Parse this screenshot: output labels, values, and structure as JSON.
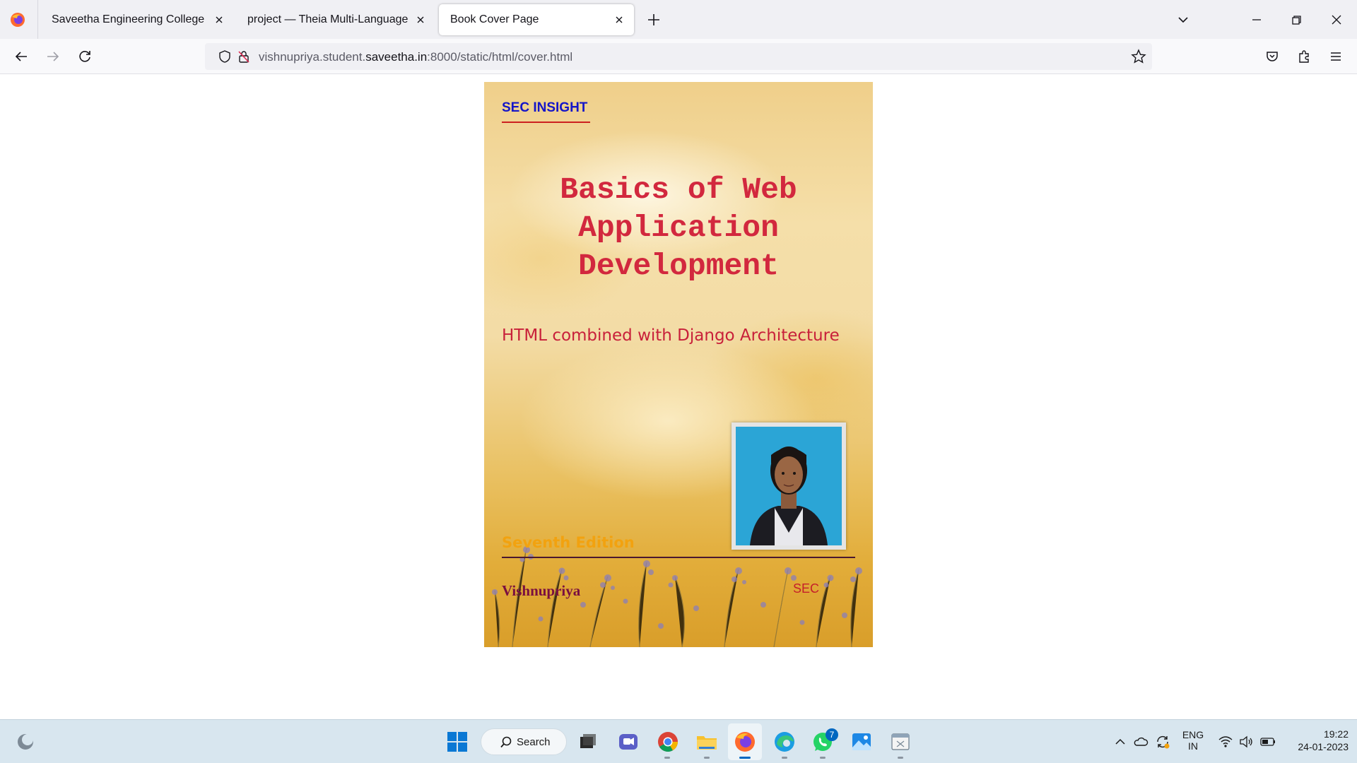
{
  "browser": {
    "tabs": [
      {
        "title": "Saveetha Engineering College",
        "active": false
      },
      {
        "title": "project — Theia Multi-Language Ex",
        "active": false
      },
      {
        "title": "Book Cover Page",
        "active": true
      }
    ],
    "url": {
      "prefix": "vishnupriya.student.",
      "domain": "saveetha.in",
      "suffix": ":8000/static/html/cover.html"
    }
  },
  "cover": {
    "brand": "SEC INSIGHT",
    "title": "Basics of Web Application Development",
    "subtitle": "HTML combined with Django Architecture",
    "edition": "Seventh Edition",
    "author": "Vishnupriya",
    "publisher": "SEC"
  },
  "taskbar": {
    "search_label": "Search",
    "whatsapp_badge": "7",
    "language": "ENG",
    "region": "IN",
    "time": "19:22",
    "date": "24-01-2023"
  },
  "colors": {
    "accent": "#0067c0",
    "brand_text": "#1515c8",
    "title_text": "#d2283e",
    "edition_text": "#f2a20f",
    "author_text": "#7a1040"
  }
}
